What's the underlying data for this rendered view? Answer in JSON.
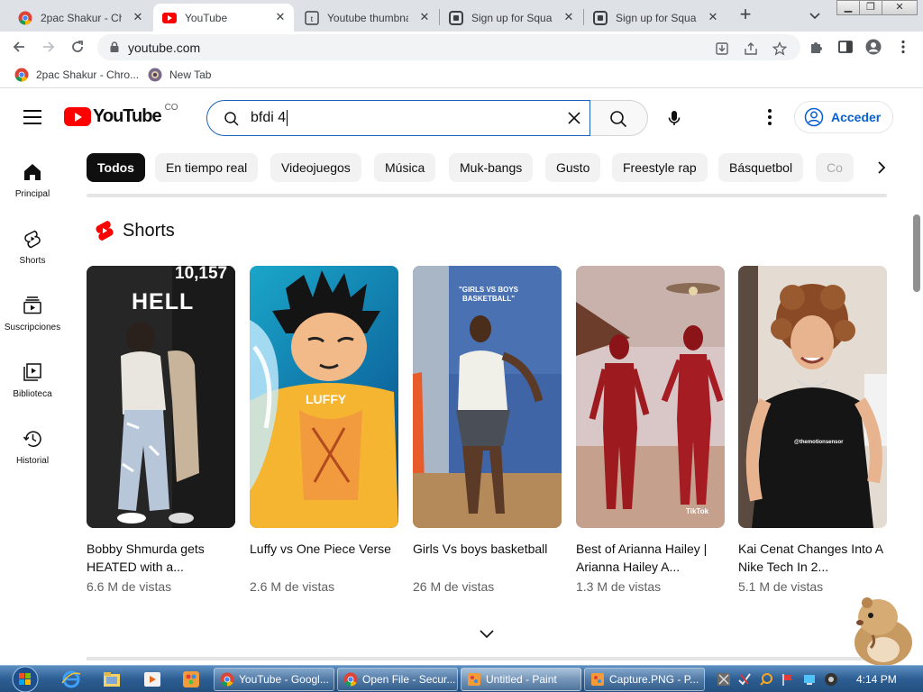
{
  "browser": {
    "tabs": [
      {
        "title": "2pac Shakur - Chr",
        "favicon": "chrome-icon"
      },
      {
        "title": "YouTube",
        "favicon": "youtube-icon",
        "active": true
      },
      {
        "title": "Youtube thumbna",
        "favicon": "text-icon"
      },
      {
        "title": "Sign up for Squar",
        "favicon": "square-icon"
      },
      {
        "title": "Sign up for Squar",
        "favicon": "square-icon"
      }
    ],
    "url": "youtube.com",
    "bookmarks": [
      {
        "label": "2pac Shakur - Chro...",
        "icon": "chrome-icon"
      },
      {
        "label": "New Tab",
        "icon": "newtab-icon"
      }
    ]
  },
  "youtube": {
    "country": "CO",
    "search_query": "bfdi 4",
    "sign_in": "Acceder",
    "guide": [
      {
        "label": "Principal",
        "icon": "home-icon"
      },
      {
        "label": "Shorts",
        "icon": "shorts-icon"
      },
      {
        "label": "Suscripciones",
        "icon": "subscriptions-icon"
      },
      {
        "label": "Biblioteca",
        "icon": "library-icon"
      },
      {
        "label": "Historial",
        "icon": "history-icon"
      }
    ],
    "chips": [
      "Todos",
      "En tiempo real",
      "Videojuegos",
      "Música",
      "Muk-bangs",
      "Gusto",
      "Freestyle rap",
      "Básquetbol",
      "Co"
    ],
    "shorts_title": "Shorts",
    "shorts": [
      {
        "title": "Bobby Shmurda gets HEATED with a...",
        "views": "6.6 M de vistas",
        "overlay": "HELL",
        "overlay2": "10,157"
      },
      {
        "title": "Luffy vs One Piece Verse",
        "views": "2.6 M de vistas",
        "overlay": "LUFFY"
      },
      {
        "title": "Girls Vs boys basketball",
        "views": "26 M de vistas",
        "overlay": "\"GIRLS VS BOYS BASKETBALL\""
      },
      {
        "title": "Best of Arianna Hailey | Arianna Hailey A...",
        "views": "1.3 M de vistas",
        "overlay": "TikTok"
      },
      {
        "title": "Kai Cenat Changes Into A Nike Tech In 2...",
        "views": "5.1 M de vistas",
        "overlay": "@themotionsensor"
      }
    ]
  },
  "taskbar": {
    "buttons": [
      "YouTube - Googl...",
      "Open File - Secur...",
      "Untitled - Paint",
      "Capture.PNG - P..."
    ],
    "time": "4:14 PM"
  }
}
